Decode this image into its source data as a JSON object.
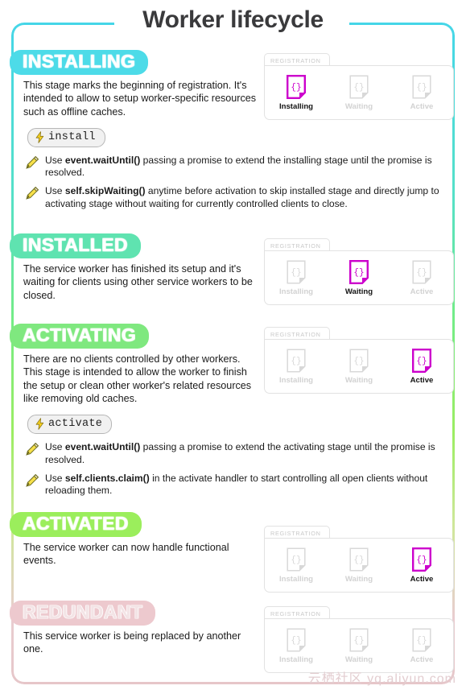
{
  "page": {
    "title": "Worker lifecycle",
    "watermark": "云栖社区 yq.aliyun.com",
    "frame_gradient_colors": [
      "#45d6e8",
      "#55e0c8",
      "#74ec86",
      "#9ced62",
      "#cfe79a",
      "#e9cdd0"
    ]
  },
  "registration_card": {
    "tab_label": "REGISTRATION",
    "slot_labels": [
      "Installing",
      "Waiting",
      "Active"
    ],
    "active_color": "#cc00cc",
    "inactive_color": "#d8d8d8"
  },
  "stages": [
    {
      "name": "INSTALLING",
      "pill_color": "#4ddbe8",
      "description": "This stage marks the beginning of registration. It's intended to allow to setup worker-specific resources such as offline caches.",
      "event_badge": "install",
      "active_slot": 0,
      "tips": [
        {
          "code": "event.waitUntil()",
          "before": "Use ",
          "after": " passing a promise to extend the installing stage until the promise is resolved."
        },
        {
          "code": "self.skipWaiting()",
          "before": "Use ",
          "after": " anytime before activation to skip installed stage and directly jump to activating stage without waiting for currently controlled clients to close."
        }
      ]
    },
    {
      "name": "INSTALLED",
      "pill_color": "#5fe3b0",
      "description": "The service worker has finished its setup and it's waiting for clients using other service workers to be closed.",
      "event_badge": null,
      "active_slot": 1,
      "tips": []
    },
    {
      "name": "ACTIVATING",
      "pill_color": "#7fe87f",
      "description": "There are no clients controlled by other workers. This stage is intended to allow the worker to finish the setup or clean other worker's related resources like removing old caches.",
      "event_badge": "activate",
      "active_slot": 2,
      "tips": [
        {
          "code": "event.waitUntil()",
          "before": "Use ",
          "after": " passing a promise to extend the activating stage until the promise is resolved."
        },
        {
          "code": "self.clients.claim()",
          "before": "Use ",
          "after": "  in the activate handler to start controlling all open clients without reloading them."
        }
      ]
    },
    {
      "name": "ACTIVATED",
      "pill_color": "#9bee5c",
      "description": "The service worker can now handle functional events.",
      "event_badge": null,
      "active_slot": 2,
      "tips": []
    },
    {
      "name": "REDUNDANT",
      "pill_color": "#edc9ce",
      "description": "This service worker is being replaced by another one.",
      "event_badge": null,
      "active_slot": -1,
      "tips": []
    }
  ]
}
